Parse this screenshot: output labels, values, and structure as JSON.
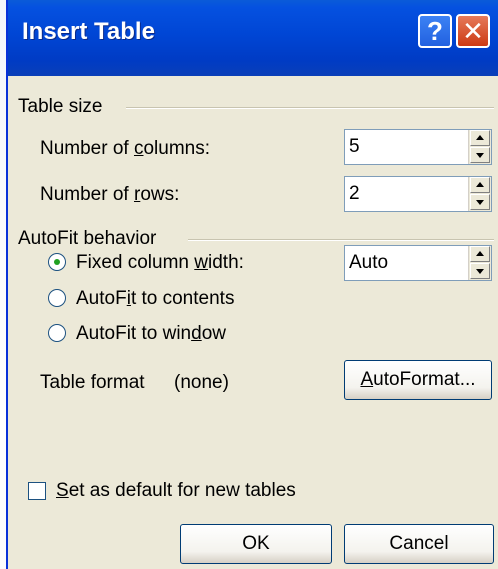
{
  "window": {
    "title": "Insert Table",
    "help_glyph": "?",
    "close_glyph": "✕"
  },
  "table_size": {
    "heading": "Table size",
    "columns_label_pre": "Number of ",
    "columns_label_u": "c",
    "columns_label_post": "olumns:",
    "columns_value": "5",
    "rows_label_pre": "Number of ",
    "rows_label_u": "r",
    "rows_label_post": "ows:",
    "rows_value": "2"
  },
  "autofit": {
    "heading": "AutoFit behavior",
    "fixed_pre": "Fixed column ",
    "fixed_u": "w",
    "fixed_post": "idth:",
    "fixed_value": "Auto",
    "contents_pre": "AutoF",
    "contents_u": "i",
    "contents_post": "t to contents",
    "window_pre": "AutoFit to win",
    "window_u": "d",
    "window_post": "ow",
    "selected": "fixed"
  },
  "table_format": {
    "label": "Table format",
    "value": "(none)",
    "button_u": "A",
    "button_post": "utoFormat..."
  },
  "default_checkbox": {
    "u": "S",
    "post": "et as default for new tables",
    "checked": false
  },
  "buttons": {
    "ok": "OK",
    "cancel": "Cancel"
  }
}
